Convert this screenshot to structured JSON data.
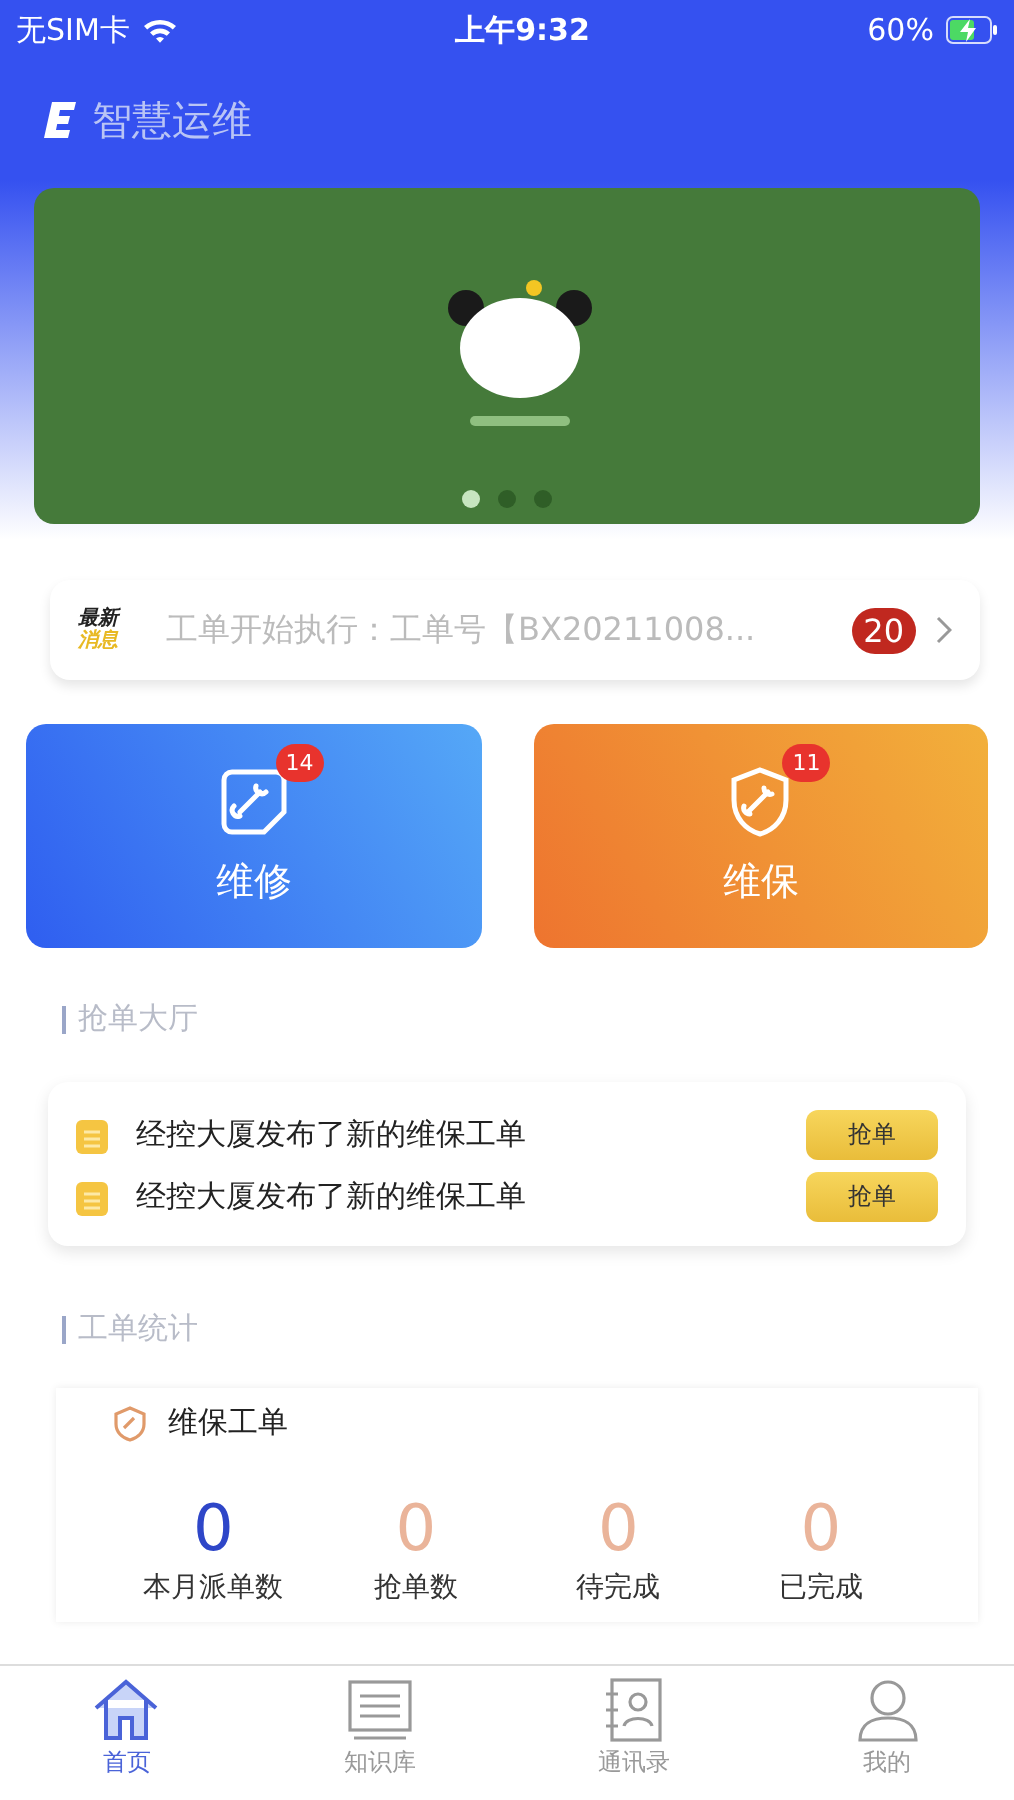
{
  "status_bar": {
    "carrier": "无SIM卡",
    "time": "上午9:32",
    "battery": "60%"
  },
  "header": {
    "title": "智慧运维"
  },
  "banner": {
    "pages": [
      {
        "selected": true
      },
      {
        "selected": false
      },
      {
        "selected": false
      }
    ]
  },
  "notice": {
    "label_top": "最新",
    "label_bottom": "消息",
    "text": "工单开始执行：工单号【BX20211008...",
    "count": "20"
  },
  "tiles": [
    {
      "kind": "repair",
      "label": "维修",
      "badge": "14"
    },
    {
      "kind": "maintain",
      "label": "维保",
      "badge": "11"
    }
  ],
  "grab_hall": {
    "title": "抢单大厅",
    "items": [
      {
        "text": "经控大厦发布了新的维保工单",
        "action": "抢单"
      },
      {
        "text": "经控大厦发布了新的维保工单",
        "action": "抢单"
      }
    ]
  },
  "order_stats": {
    "title": "工单统计",
    "card_title": "维保工单",
    "stats": [
      {
        "value": "0",
        "label": "本月派单数",
        "kind": "primary"
      },
      {
        "value": "0",
        "label": "抢单数",
        "kind": "muted"
      },
      {
        "value": "0",
        "label": "待完成",
        "kind": "muted"
      },
      {
        "value": "0",
        "label": "已完成",
        "kind": "muted"
      }
    ]
  },
  "tab_bar": [
    {
      "kind": "home",
      "label": "首页",
      "selected": true
    },
    {
      "kind": "knowledge",
      "label": "知识库",
      "selected": false
    },
    {
      "kind": "contacts",
      "label": "通讯录",
      "selected": false
    },
    {
      "kind": "profile",
      "label": "我的",
      "selected": false
    }
  ]
}
